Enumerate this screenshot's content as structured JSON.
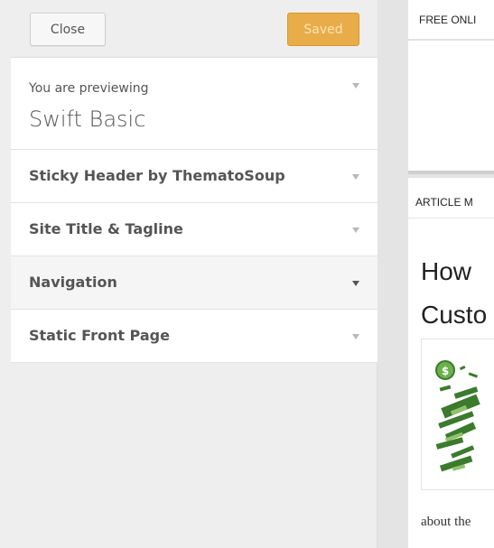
{
  "header": {
    "close_label": "Close",
    "saved_label": "Saved"
  },
  "preview": {
    "label": "You are previewing",
    "theme_name": "Swift Basic"
  },
  "sections": [
    {
      "title": "Sticky Header by ThematoSoup",
      "expanded": false
    },
    {
      "title": "Site Title & Tagline",
      "expanded": false
    },
    {
      "title": "Navigation",
      "expanded": false,
      "hovered": true
    },
    {
      "title": "Static Front Page",
      "expanded": false
    }
  ],
  "site_preview": {
    "top_menu_text": "FREE ONLI",
    "article_menu_text": "ARTICLE M",
    "post_title_line1": "How",
    "post_title_line2": "Custo",
    "excerpt_text": "about the"
  },
  "colors": {
    "saved_button": "#e8ad49",
    "sidebar_bg": "#eeeeee",
    "panel_bg": "#ffffff",
    "thumbnail_green": "#3c7a2e"
  },
  "icons": {
    "section_toggle": "triangle-down-icon"
  }
}
